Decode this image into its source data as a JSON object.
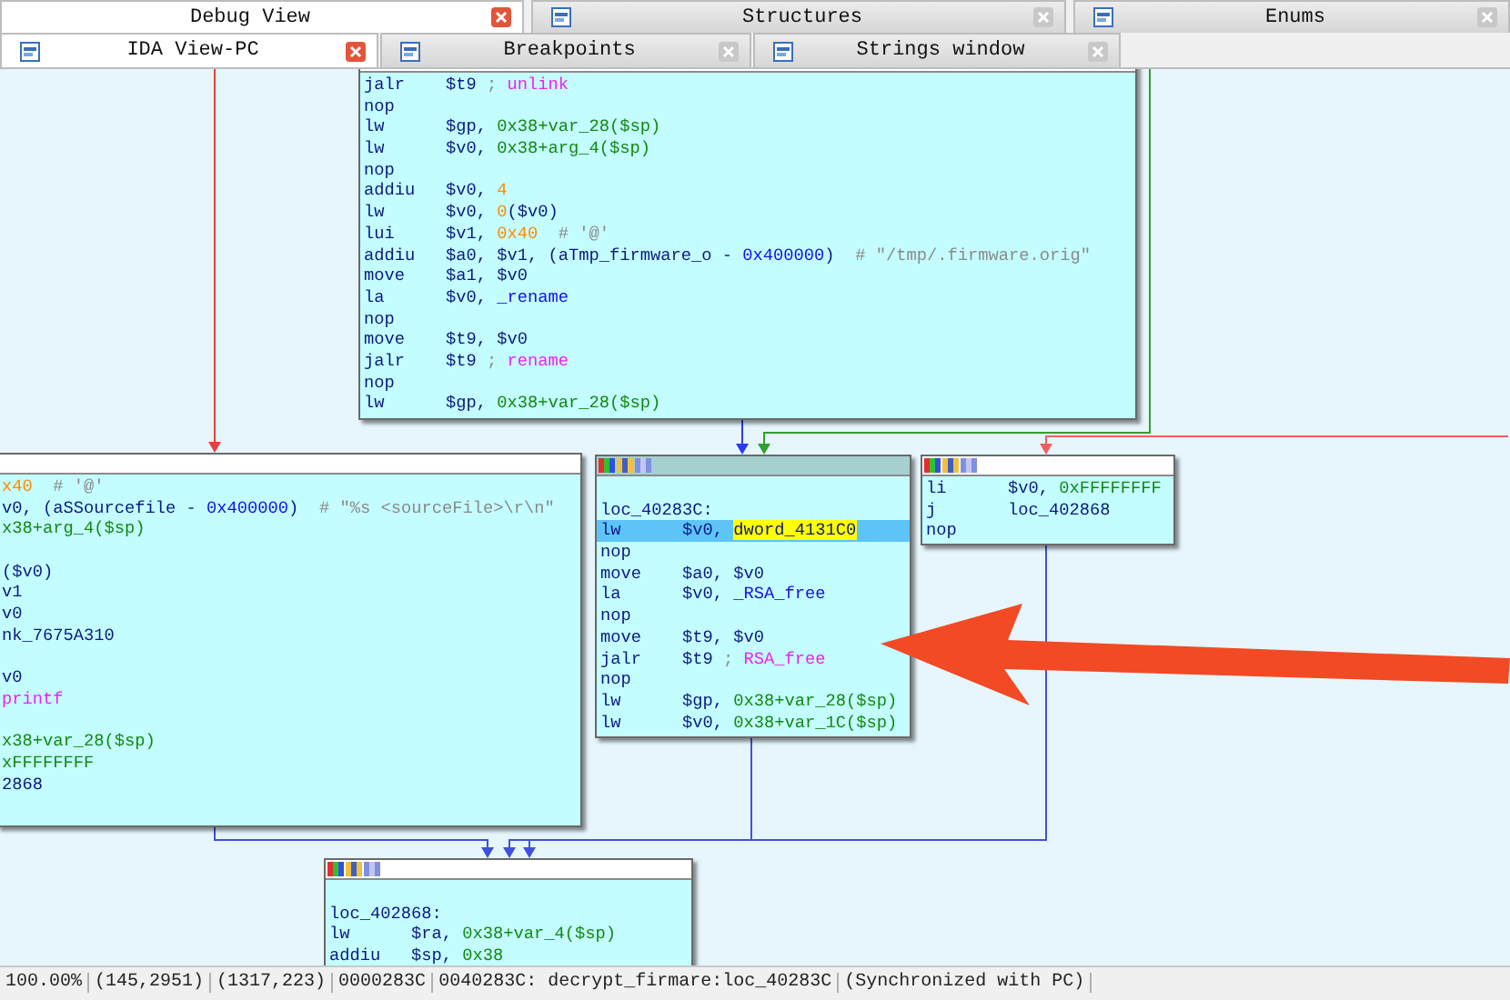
{
  "tabs_top": [
    {
      "label": "Debug View",
      "selected": true
    },
    {
      "label": "Structures",
      "selected": false
    },
    {
      "label": "Enums",
      "selected": false
    }
  ],
  "tabs_bottom": [
    {
      "label": "IDA View-PC",
      "selected": true
    },
    {
      "label": "Breakpoints",
      "selected": false
    },
    {
      "label": "Strings window",
      "selected": false
    }
  ],
  "graph": {
    "nodes": [
      {
        "selected": false,
        "lines": [
          {
            "kind": "code",
            "selected": false,
            "segments": [
              {
                "text": "jalr",
                "kind": "mn"
              },
              {
                "text": "$t9",
                "kind": "ins"
              },
              {
                "text": " ; ",
                "kind": "cmt"
              },
              {
                "text": "unlink",
                "kind": "imp"
              }
            ]
          },
          {
            "kind": "code",
            "selected": false,
            "segments": [
              {
                "text": "nop",
                "kind": "mn"
              }
            ]
          },
          {
            "kind": "code",
            "selected": false,
            "segments": [
              {
                "text": "lw",
                "kind": "mn"
              },
              {
                "text": "$gp, ",
                "kind": "ins"
              },
              {
                "text": "0x38+var_28($sp)",
                "kind": "off"
              }
            ]
          },
          {
            "kind": "code",
            "selected": false,
            "segments": [
              {
                "text": "lw",
                "kind": "mn"
              },
              {
                "text": "$v0, ",
                "kind": "ins"
              },
              {
                "text": "0x38+arg_4($sp)",
                "kind": "off"
              }
            ]
          },
          {
            "kind": "code",
            "selected": false,
            "segments": [
              {
                "text": "nop",
                "kind": "mn"
              }
            ]
          },
          {
            "kind": "code",
            "selected": false,
            "segments": [
              {
                "text": "addiu",
                "kind": "mn"
              },
              {
                "text": "$v0, ",
                "kind": "ins"
              },
              {
                "text": "4",
                "kind": "num"
              }
            ]
          },
          {
            "kind": "code",
            "selected": false,
            "segments": [
              {
                "text": "lw",
                "kind": "mn"
              },
              {
                "text": "$v0, ",
                "kind": "ins"
              },
              {
                "text": "0",
                "kind": "num"
              },
              {
                "text": "($v0)",
                "kind": "ins"
              }
            ]
          },
          {
            "kind": "code",
            "selected": false,
            "segments": [
              {
                "text": "lui",
                "kind": "mn"
              },
              {
                "text": "$v1, ",
                "kind": "ins"
              },
              {
                "text": "0x40",
                "kind": "num"
              },
              {
                "text": "  # '@'",
                "kind": "cmt"
              }
            ]
          },
          {
            "kind": "code",
            "selected": false,
            "segments": [
              {
                "text": "addiu",
                "kind": "mn"
              },
              {
                "text": "$a0, $v1, (aTmp_firmware_o - ",
                "kind": "ins"
              },
              {
                "text": "0x400000",
                "kind": "sym"
              },
              {
                "text": ")",
                "kind": "ins"
              },
              {
                "text": "  # \"/tmp/.firmware.orig\"",
                "kind": "cmt"
              }
            ]
          },
          {
            "kind": "code",
            "selected": false,
            "segments": [
              {
                "text": "move",
                "kind": "mn"
              },
              {
                "text": "$a1, $v0",
                "kind": "ins"
              }
            ]
          },
          {
            "kind": "code",
            "selected": false,
            "segments": [
              {
                "text": "la",
                "kind": "mn"
              },
              {
                "text": "$v0, ",
                "kind": "ins"
              },
              {
                "text": "_rename",
                "kind": "sym"
              }
            ]
          },
          {
            "kind": "code",
            "selected": false,
            "segments": [
              {
                "text": "nop",
                "kind": "mn"
              }
            ]
          },
          {
            "kind": "code",
            "selected": false,
            "segments": [
              {
                "text": "move",
                "kind": "mn"
              },
              {
                "text": "$t9, $v0",
                "kind": "ins"
              }
            ]
          },
          {
            "kind": "code",
            "selected": false,
            "segments": [
              {
                "text": "jalr",
                "kind": "mn"
              },
              {
                "text": "$t9",
                "kind": "ins"
              },
              {
                "text": " ; ",
                "kind": "cmt"
              },
              {
                "text": "rename",
                "kind": "imp"
              }
            ]
          },
          {
            "kind": "code",
            "selected": false,
            "segments": [
              {
                "text": "nop",
                "kind": "mn"
              }
            ]
          },
          {
            "kind": "code",
            "selected": false,
            "segments": [
              {
                "text": "lw",
                "kind": "mn"
              },
              {
                "text": "$gp, ",
                "kind": "ins"
              },
              {
                "text": "0x38+var_28($sp)",
                "kind": "off"
              }
            ]
          }
        ]
      },
      {
        "selected": false,
        "toolbar_icons": false,
        "lines": [
          {
            "kind": "code",
            "selected": false,
            "segments": [
              {
                "text": "x40",
                "kind": "num"
              },
              {
                "text": "  # '@'",
                "kind": "cmt"
              }
            ]
          },
          {
            "kind": "code",
            "selected": false,
            "segments": [
              {
                "text": "v0, (aSSourcefile - ",
                "kind": "ins"
              },
              {
                "text": "0x400000",
                "kind": "sym"
              },
              {
                "text": ")",
                "kind": "ins"
              },
              {
                "text": "  # \"%s <sourceFile>\\r\\n\"",
                "kind": "cmt"
              }
            ]
          },
          {
            "kind": "code",
            "selected": false,
            "segments": [
              {
                "text": "x38+arg_4($sp)",
                "kind": "off"
              }
            ]
          },
          {
            "kind": "blank"
          },
          {
            "kind": "code",
            "selected": false,
            "segments": [
              {
                "text": "($v0)",
                "kind": "ins"
              }
            ]
          },
          {
            "kind": "code",
            "selected": false,
            "segments": [
              {
                "text": "v1",
                "kind": "ins"
              }
            ]
          },
          {
            "kind": "code",
            "selected": false,
            "segments": [
              {
                "text": "v0",
                "kind": "ins"
              }
            ]
          },
          {
            "kind": "code",
            "selected": false,
            "segments": [
              {
                "text": "nk_7675A310",
                "kind": "ins"
              }
            ]
          },
          {
            "kind": "blank"
          },
          {
            "kind": "code",
            "selected": false,
            "segments": [
              {
                "text": "v0",
                "kind": "ins"
              }
            ]
          },
          {
            "kind": "code",
            "selected": false,
            "segments": [
              {
                "text": "printf",
                "kind": "imp"
              }
            ]
          },
          {
            "kind": "blank"
          },
          {
            "kind": "code",
            "selected": false,
            "segments": [
              {
                "text": "x38+var_28($sp)",
                "kind": "off"
              }
            ]
          },
          {
            "kind": "code",
            "selected": false,
            "segments": [
              {
                "text": "xFFFFFFFF",
                "kind": "off"
              }
            ]
          },
          {
            "kind": "code",
            "selected": false,
            "segments": [
              {
                "text": "2868",
                "kind": "ins"
              }
            ]
          }
        ]
      },
      {
        "selected": true,
        "toolbar_icons": true,
        "lines": [
          {
            "kind": "blank"
          },
          {
            "kind": "code",
            "selected": false,
            "segments": [
              {
                "text": "loc_40283C:",
                "kind": "ins"
              }
            ]
          },
          {
            "kind": "code",
            "selected": true,
            "segments": [
              {
                "text": "lw",
                "kind": "mn"
              },
              {
                "text": "$v0, ",
                "kind": "ins"
              },
              {
                "text": "dword_4131C0",
                "kind": "hl"
              }
            ]
          },
          {
            "kind": "code",
            "selected": false,
            "segments": [
              {
                "text": "nop",
                "kind": "mn"
              }
            ]
          },
          {
            "kind": "code",
            "selected": false,
            "segments": [
              {
                "text": "move",
                "kind": "mn"
              },
              {
                "text": "$a0, $v0",
                "kind": "ins"
              }
            ]
          },
          {
            "kind": "code",
            "selected": false,
            "segments": [
              {
                "text": "la",
                "kind": "mn"
              },
              {
                "text": "$v0, ",
                "kind": "ins"
              },
              {
                "text": "_RSA_free",
                "kind": "sym"
              }
            ]
          },
          {
            "kind": "code",
            "selected": false,
            "segments": [
              {
                "text": "nop",
                "kind": "mn"
              }
            ]
          },
          {
            "kind": "code",
            "selected": false,
            "segments": [
              {
                "text": "move",
                "kind": "mn"
              },
              {
                "text": "$t9, $v0",
                "kind": "ins"
              }
            ]
          },
          {
            "kind": "code",
            "selected": false,
            "segments": [
              {
                "text": "jalr",
                "kind": "mn"
              },
              {
                "text": "$t9",
                "kind": "ins"
              },
              {
                "text": " ; ",
                "kind": "cmt"
              },
              {
                "text": "RSA_free",
                "kind": "imp"
              }
            ]
          },
          {
            "kind": "code",
            "selected": false,
            "segments": [
              {
                "text": "nop",
                "kind": "mn"
              }
            ]
          },
          {
            "kind": "code",
            "selected": false,
            "segments": [
              {
                "text": "lw",
                "kind": "mn"
              },
              {
                "text": "$gp, ",
                "kind": "ins"
              },
              {
                "text": "0x38+var_28($sp)",
                "kind": "off"
              }
            ]
          },
          {
            "kind": "code",
            "selected": false,
            "segments": [
              {
                "text": "lw",
                "kind": "mn"
              },
              {
                "text": "$v0, ",
                "kind": "ins"
              },
              {
                "text": "0x38+var_1C($sp)",
                "kind": "off"
              }
            ]
          }
        ]
      },
      {
        "selected": false,
        "toolbar_icons": true,
        "lines": [
          {
            "kind": "code",
            "selected": false,
            "segments": [
              {
                "text": "li",
                "kind": "mn"
              },
              {
                "text": "$v0, ",
                "kind": "ins"
              },
              {
                "text": "0xFFFFFFFF",
                "kind": "off"
              }
            ]
          },
          {
            "kind": "code",
            "selected": false,
            "segments": [
              {
                "text": "j",
                "kind": "mn"
              },
              {
                "text": "loc_402868",
                "kind": "ins"
              }
            ]
          },
          {
            "kind": "code",
            "selected": false,
            "segments": [
              {
                "text": "nop",
                "kind": "mn"
              }
            ]
          }
        ]
      },
      {
        "selected": false,
        "toolbar_icons": true,
        "lines": [
          {
            "kind": "blank"
          },
          {
            "kind": "code",
            "selected": false,
            "segments": [
              {
                "text": "loc_402868:",
                "kind": "ins"
              }
            ]
          },
          {
            "kind": "code",
            "selected": false,
            "segments": [
              {
                "text": "lw",
                "kind": "mn"
              },
              {
                "text": "$ra, ",
                "kind": "ins"
              },
              {
                "text": "0x38+var_4($sp)",
                "kind": "off"
              }
            ]
          },
          {
            "kind": "code",
            "selected": false,
            "segments": [
              {
                "text": "addiu",
                "kind": "mn"
              },
              {
                "text": "$sp, ",
                "kind": "ins"
              },
              {
                "text": "0x38",
                "kind": "off"
              }
            ]
          }
        ]
      }
    ]
  },
  "status_bar": [
    "100.00%",
    "(145,2951)",
    "(1317,223)",
    "0000283C",
    "0040283C: decrypt_firmare:loc_40283C",
    "(Synchronized with PC)"
  ]
}
